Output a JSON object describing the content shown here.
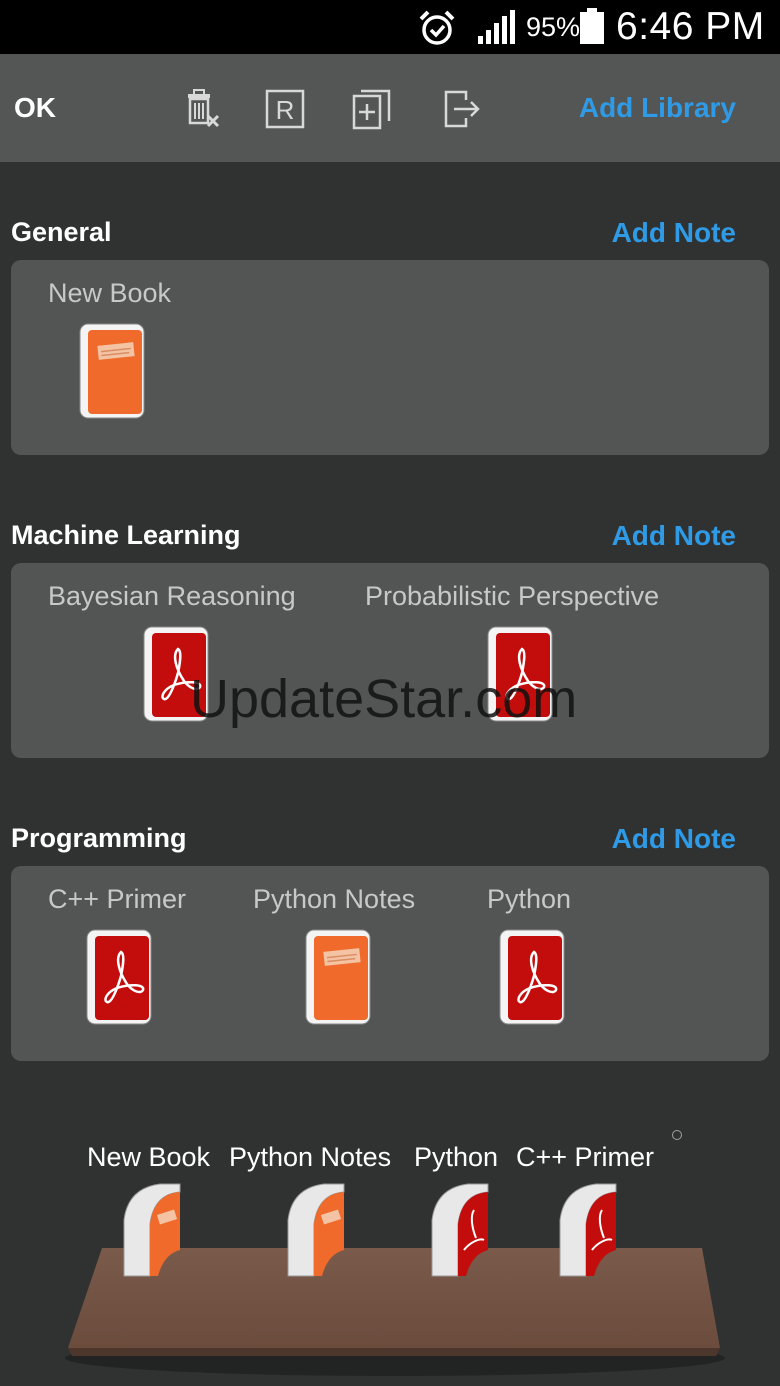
{
  "status_bar": {
    "battery_pct": "95%",
    "time": "6:46 PM"
  },
  "toolbar": {
    "ok_label": "OK",
    "icons": [
      "delete-icon",
      "rename-icon",
      "add-page-icon",
      "export-icon"
    ],
    "add_library_label": "Add Library"
  },
  "accent_color": "#2f9be6",
  "libraries": [
    {
      "title": "General",
      "add_note_label": "Add Note",
      "books": [
        {
          "label": "New Book",
          "type": "note"
        }
      ]
    },
    {
      "title": "Machine  Learning",
      "add_note_label": "Add Note",
      "books": [
        {
          "label": "Bayesian Reasoning",
          "type": "pdf"
        },
        {
          "label": "Probabilistic Perspective",
          "type": "pdf"
        }
      ]
    },
    {
      "title": "Programming",
      "add_note_label": "Add Note",
      "books": [
        {
          "label": "C++ Primer",
          "type": "pdf"
        },
        {
          "label": "Python Notes",
          "type": "note"
        },
        {
          "label": "Python",
          "type": "pdf"
        }
      ]
    }
  ],
  "shelf": {
    "books": [
      {
        "label": "New Book",
        "type": "note"
      },
      {
        "label": "Python Notes",
        "type": "note"
      },
      {
        "label": "Python",
        "type": "pdf"
      },
      {
        "label": "C++ Primer",
        "type": "pdf"
      }
    ]
  },
  "watermark": "UpdateStar.com"
}
